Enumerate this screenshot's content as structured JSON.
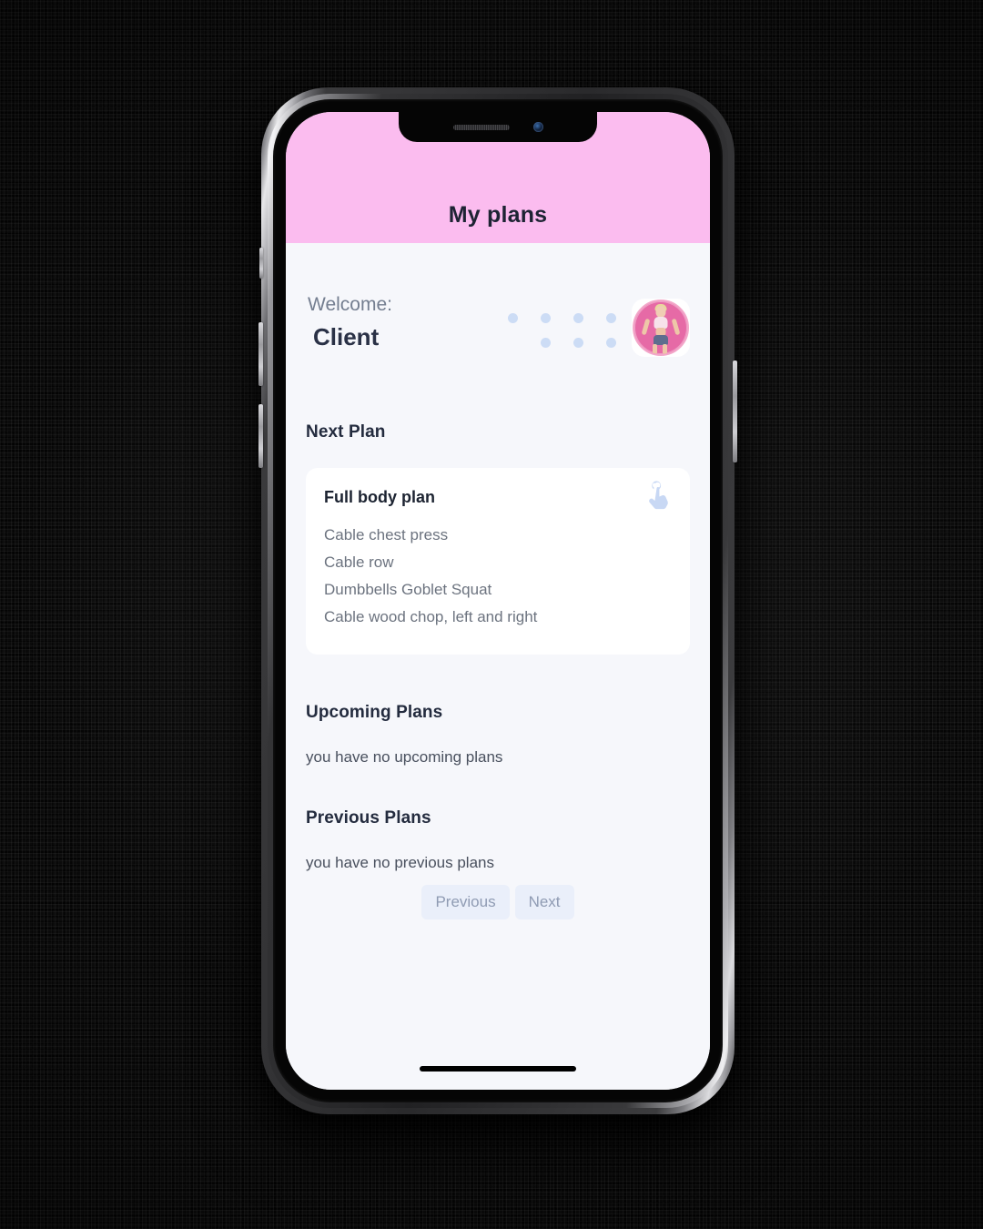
{
  "app": {
    "header": {
      "title": "My plans"
    },
    "welcome": {
      "label": "Welcome:",
      "name": "Client",
      "avatar_alt": "client-avatar"
    },
    "sections": {
      "next": {
        "heading": "Next Plan",
        "card": {
          "title": "Full body plan",
          "action_icon": "tap-gesture-icon",
          "exercises": [
            "Cable chest press",
            "Cable row",
            "Dumbbells Goblet Squat",
            "Cable wood chop, left and right"
          ]
        }
      },
      "upcoming": {
        "heading": "Upcoming Plans",
        "empty_text": "you have no upcoming plans"
      },
      "previous": {
        "heading": "Previous Plans",
        "empty_text": "you have no previous plans"
      }
    },
    "pager": {
      "previous_label": "Previous",
      "next_label": "Next"
    },
    "colors": {
      "header_pink": "#fbbcef",
      "page_background": "#f6f7fb",
      "card_white": "#ffffff",
      "heading_navy": "#232b3e",
      "muted_text": "#6c737f",
      "accent_dot_blue": "#ccdcf5",
      "pager_button_bg": "#eaeffa",
      "pager_button_text": "#8f9bb3",
      "avatar_ring_pink": "#f3a7c9"
    }
  },
  "device": {
    "notch": {
      "speaker_icon": "speaker-grille-icon",
      "camera_icon": "front-camera-icon"
    },
    "buttons": {
      "silent": "silent-switch",
      "volume_up": "volume-up-button",
      "volume_down": "volume-down-button",
      "power": "power-button"
    },
    "home_indicator": "home-indicator-bar"
  }
}
